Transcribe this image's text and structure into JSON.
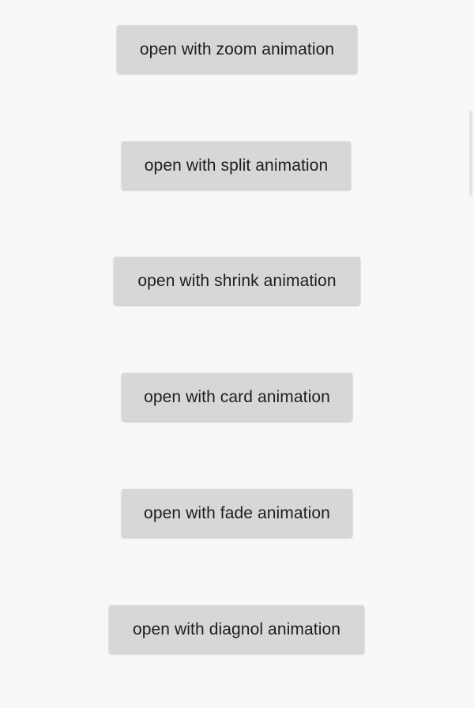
{
  "buttons": {
    "zoom": "open with zoom animation",
    "split": "open with split animation",
    "shrink": "open with shrink animation",
    "card": "open with card animation",
    "fade": "open with fade animation",
    "diagnol": "open with diagnol animation"
  },
  "colors": {
    "background": "#f9f8f7",
    "button_background": "#d8d7d6",
    "button_text": "#1e1e1e"
  }
}
